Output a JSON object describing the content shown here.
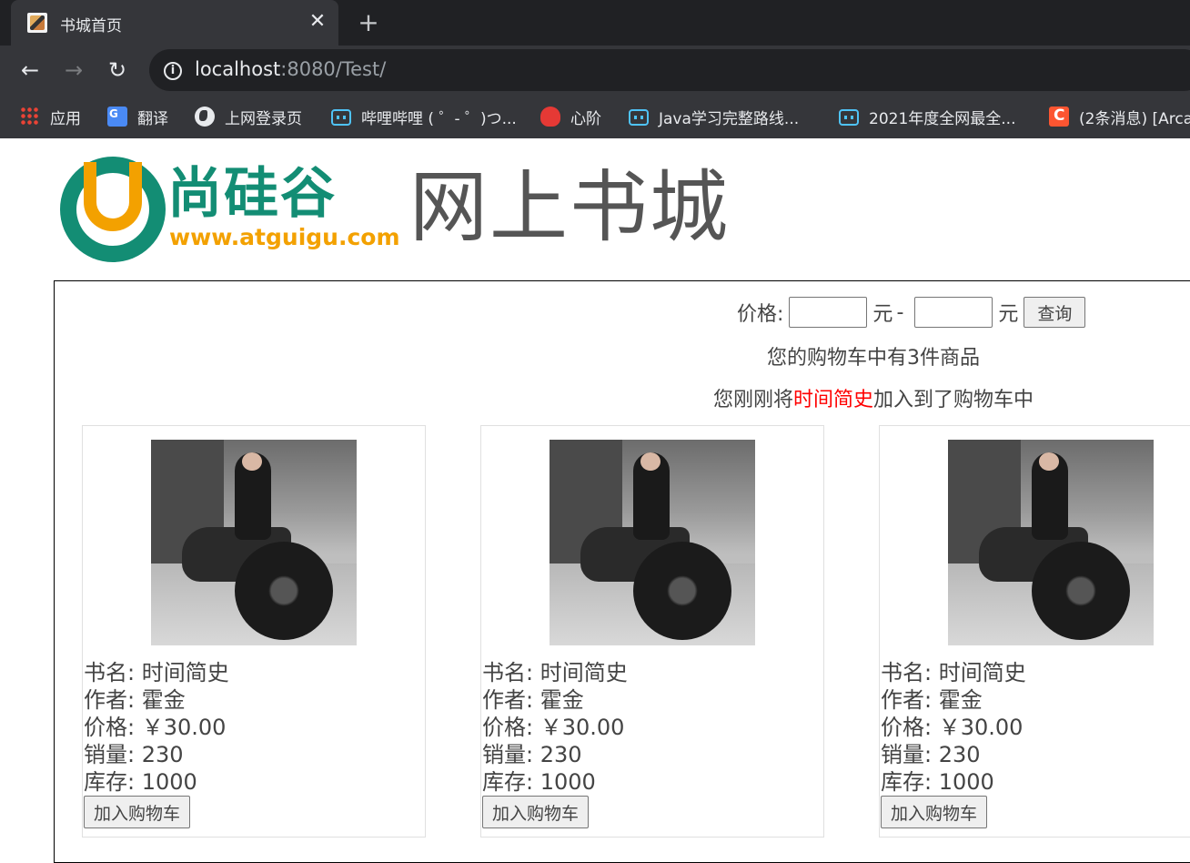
{
  "browser": {
    "tab_title": "书城首页",
    "tab_close": "✕",
    "new_tab": "+",
    "url_host": "localhost",
    "url_rest": ":8080/Test/",
    "bookmarks": [
      {
        "label": "应用",
        "icon": "apps-grid-icon"
      },
      {
        "label": "翻译",
        "icon": "translate-icon"
      },
      {
        "label": "上网登录页",
        "icon": "globe-icon"
      },
      {
        "label": "哔哩哔哩 ( ゜- ゜)つ...",
        "icon": "bilibili-icon"
      },
      {
        "label": "心阶",
        "icon": "heart-icon"
      },
      {
        "label": "Java学习完整路线...",
        "icon": "bilibili-icon"
      },
      {
        "label": "2021年度全网最全...",
        "icon": "bilibili-icon"
      },
      {
        "label": "(2条消息) [Arca",
        "icon": "csdn-icon"
      }
    ]
  },
  "header": {
    "logo_cn": "尚硅谷",
    "logo_url": "www.atguigu.com",
    "site_title": "网上书城"
  },
  "search": {
    "label": "价格:",
    "unit": "元",
    "dash": "-",
    "min_value": "",
    "max_value": "",
    "button_label": "查询"
  },
  "cart": {
    "count_text": "您的购物车中有3件商品",
    "added_prefix": "您刚刚将",
    "added_book": "时间简史",
    "added_suffix": "加入到了购物车中"
  },
  "books": [
    {
      "name_line": "书名: 时间简史",
      "author_line": "作者: 霍金",
      "price_line": "价格: ￥30.00",
      "sales_line": "销量: 230",
      "stock_line": "库存: 1000",
      "button": "加入购物车"
    },
    {
      "name_line": "书名: 时间简史",
      "author_line": "作者: 霍金",
      "price_line": "价格: ￥30.00",
      "sales_line": "销量: 230",
      "stock_line": "库存: 1000",
      "button": "加入购物车"
    },
    {
      "name_line": "书名: 时间简史",
      "author_line": "作者: 霍金",
      "price_line": "价格: ￥30.00",
      "sales_line": "销量: 230",
      "stock_line": "库存: 1000",
      "button": "加入购物车"
    }
  ],
  "colors": {
    "chrome_dark": "#202124",
    "chrome_toolbar": "#35363a",
    "logo_green": "#138d74",
    "logo_orange": "#f3a100",
    "highlight_red": "#ff0000"
  }
}
